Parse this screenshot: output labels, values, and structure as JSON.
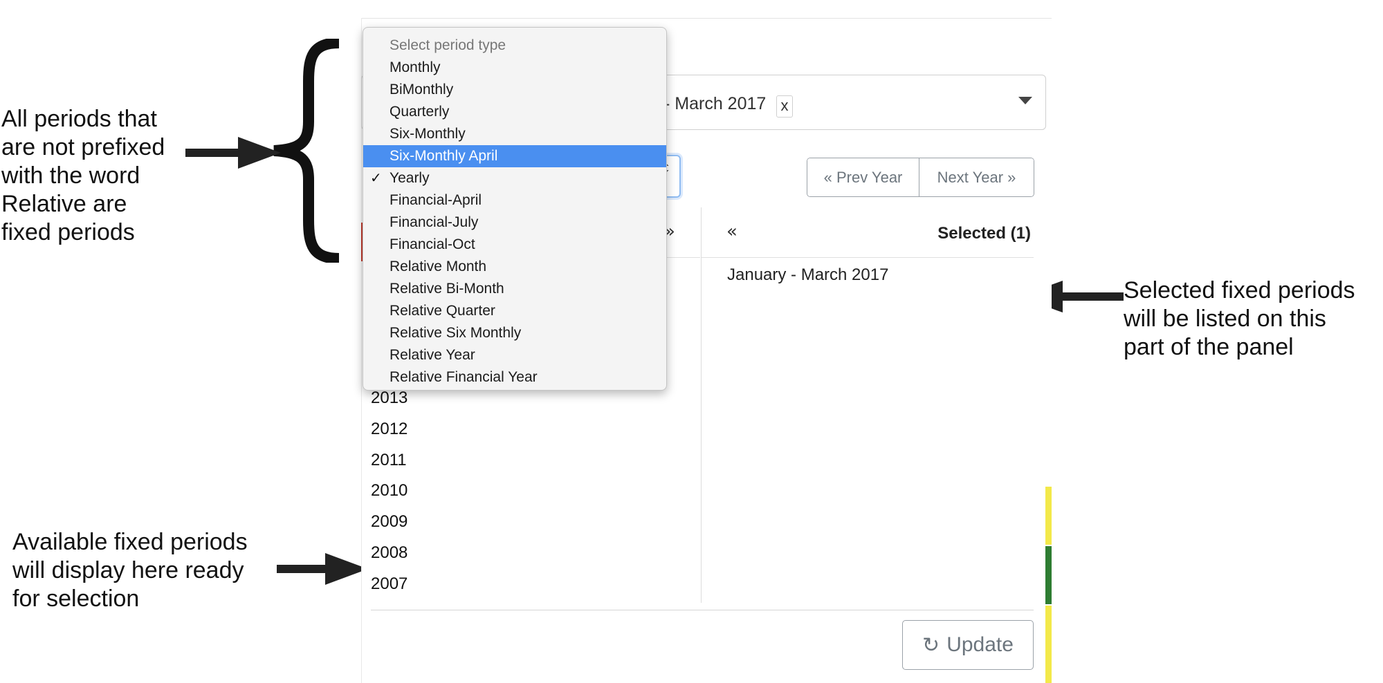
{
  "annotations": {
    "fixed_periods_note": "All periods that\nare not prefixed\nwith the word\nRelative are\nfixed periods",
    "selected_note": "Selected fixed periods\nwill be listed on this\npart of the panel",
    "available_note": "Available fixed periods\nwill display here ready\nfor selection"
  },
  "selection_box": {
    "tag_label": "- March 2017",
    "tag_remove": "x"
  },
  "period_type_dropdown": {
    "placeholder": "Select period type",
    "options": [
      {
        "label": "Monthly"
      },
      {
        "label": "BiMonthly"
      },
      {
        "label": "Quarterly"
      },
      {
        "label": "Six-Monthly"
      },
      {
        "label": "Six-Monthly April",
        "highlighted": true
      },
      {
        "label": "Yearly",
        "checked": true
      },
      {
        "label": "Financial-April"
      },
      {
        "label": "Financial-July"
      },
      {
        "label": "Financial-Oct"
      },
      {
        "label": "Relative Month"
      },
      {
        "label": "Relative Bi-Month"
      },
      {
        "label": "Relative Quarter"
      },
      {
        "label": "Relative Six Monthly"
      },
      {
        "label": "Relative Year"
      },
      {
        "label": "Relative Financial Year"
      }
    ],
    "check_glyph": "✓",
    "select_arrows": "⬍"
  },
  "year_nav": {
    "prev_label": "« Prev Year",
    "next_label": "Next Year »"
  },
  "list_headers": {
    "add_all": "»",
    "remove_all": "«",
    "selected_count": "Selected (1)"
  },
  "available_periods": [
    "2013",
    "2012",
    "2011",
    "2010",
    "2009",
    "2008",
    "2007"
  ],
  "selected_periods": [
    "January - March 2017"
  ],
  "footer": {
    "update_label": "Update",
    "update_icon": "↻"
  },
  "colors": {
    "highlight": "#4a8ff0",
    "strip_yellow": "#f3e94a",
    "strip_green": "#2e7d32",
    "marker_red": "#c0392b"
  }
}
